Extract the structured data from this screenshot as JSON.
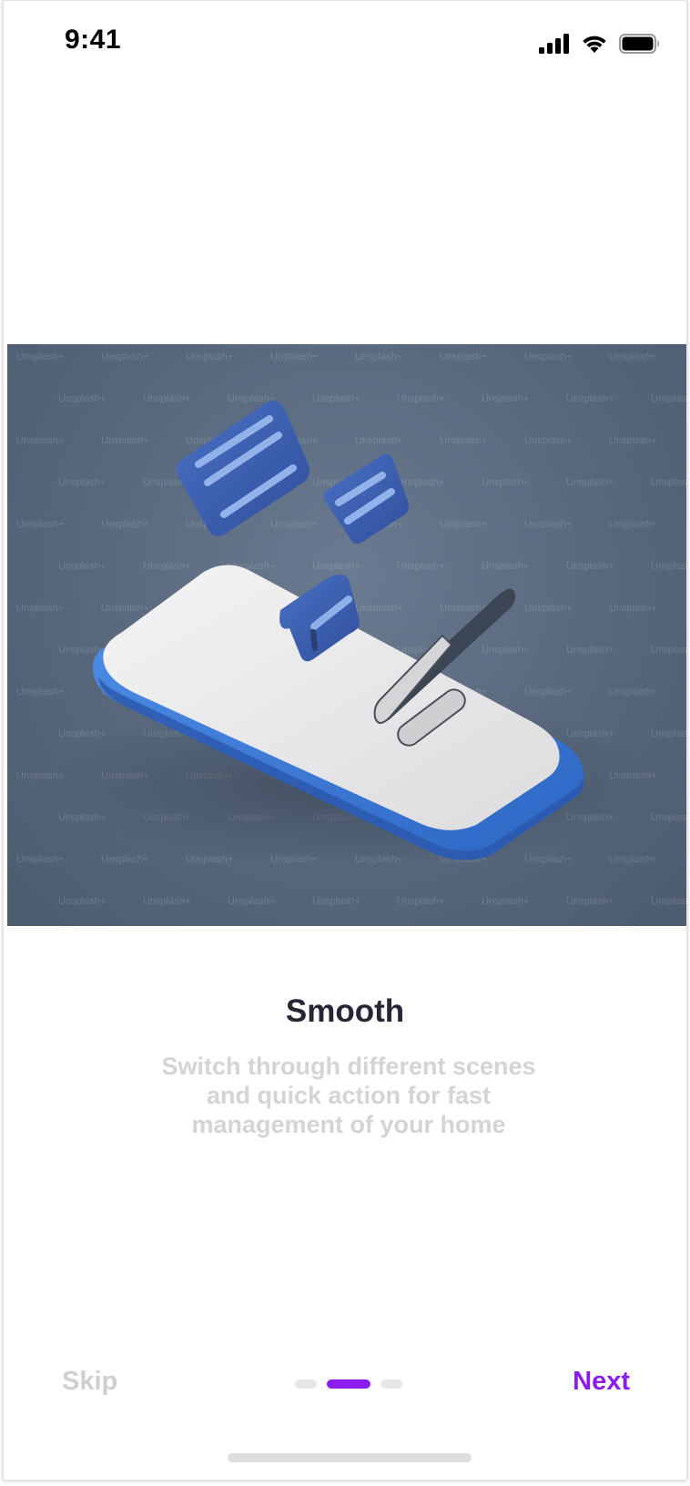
{
  "status_bar": {
    "time": "9:41",
    "icons": [
      "cellular-signal-icon",
      "wifi-icon",
      "battery-icon"
    ]
  },
  "hero": {
    "watermark": "Unsplash+",
    "colors": {
      "background": "#5a697e",
      "platform_blue": "#3f7ad6",
      "screen_white": "#e9e9eb",
      "card_blue": "#3a5fb0"
    }
  },
  "onboarding": {
    "title": "Smooth",
    "subtitle_lines": [
      "Switch through different scenes",
      "and quick action for fast",
      "management of your home"
    ],
    "page_indicator": {
      "total": 3,
      "active_index": 1
    }
  },
  "nav": {
    "skip_label": "Skip",
    "next_label": "Next"
  },
  "colors": {
    "accent": "#8a1cf0",
    "title": "#262637",
    "muted_text": "#d4d4d4"
  }
}
